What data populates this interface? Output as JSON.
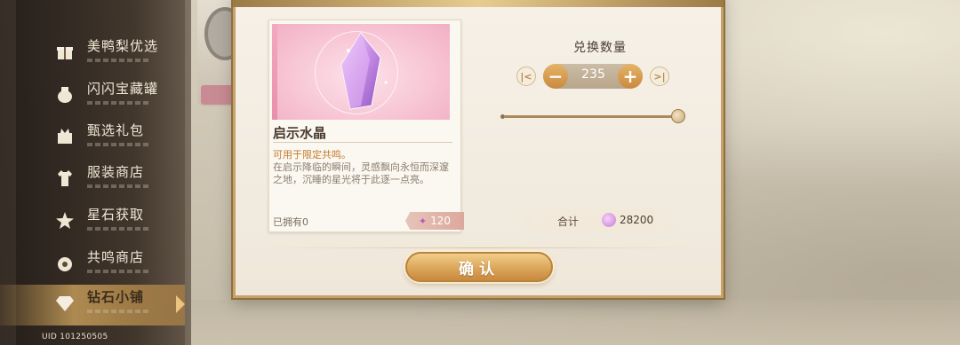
{
  "sidebar": {
    "items": [
      {
        "label": "美鸭梨优选",
        "icon": "gift-box-icon"
      },
      {
        "label": "闪闪宝藏罐",
        "icon": "treasure-jar-icon"
      },
      {
        "label": "甄选礼包",
        "icon": "gift-pack-icon"
      },
      {
        "label": "服装商店",
        "icon": "clothing-icon"
      },
      {
        "label": "星石获取",
        "icon": "star-stone-icon"
      },
      {
        "label": "共鸣商店",
        "icon": "resonance-icon"
      },
      {
        "label": "钻石小铺",
        "icon": "diamond-shop-icon",
        "active": true
      }
    ],
    "uid": "UID 101250505"
  },
  "item": {
    "name": "启示水晶",
    "usage": "可用于限定共鸣。",
    "description": "在启示降临的瞬间，灵感飘向永恒而深邃之地，沉睡的星光将于此逐一点亮。",
    "owned": "已拥有0",
    "price": "120"
  },
  "exchange": {
    "title": "兑换数量",
    "quantity": "235",
    "slider_fraction": 1.0,
    "total_label": "合计",
    "total_value": "28200"
  },
  "confirm_label": "确认",
  "colors": {
    "accent_gold": "#dba55a",
    "usage_text": "#c07b2c",
    "gem_pink": "#c27ad8"
  }
}
